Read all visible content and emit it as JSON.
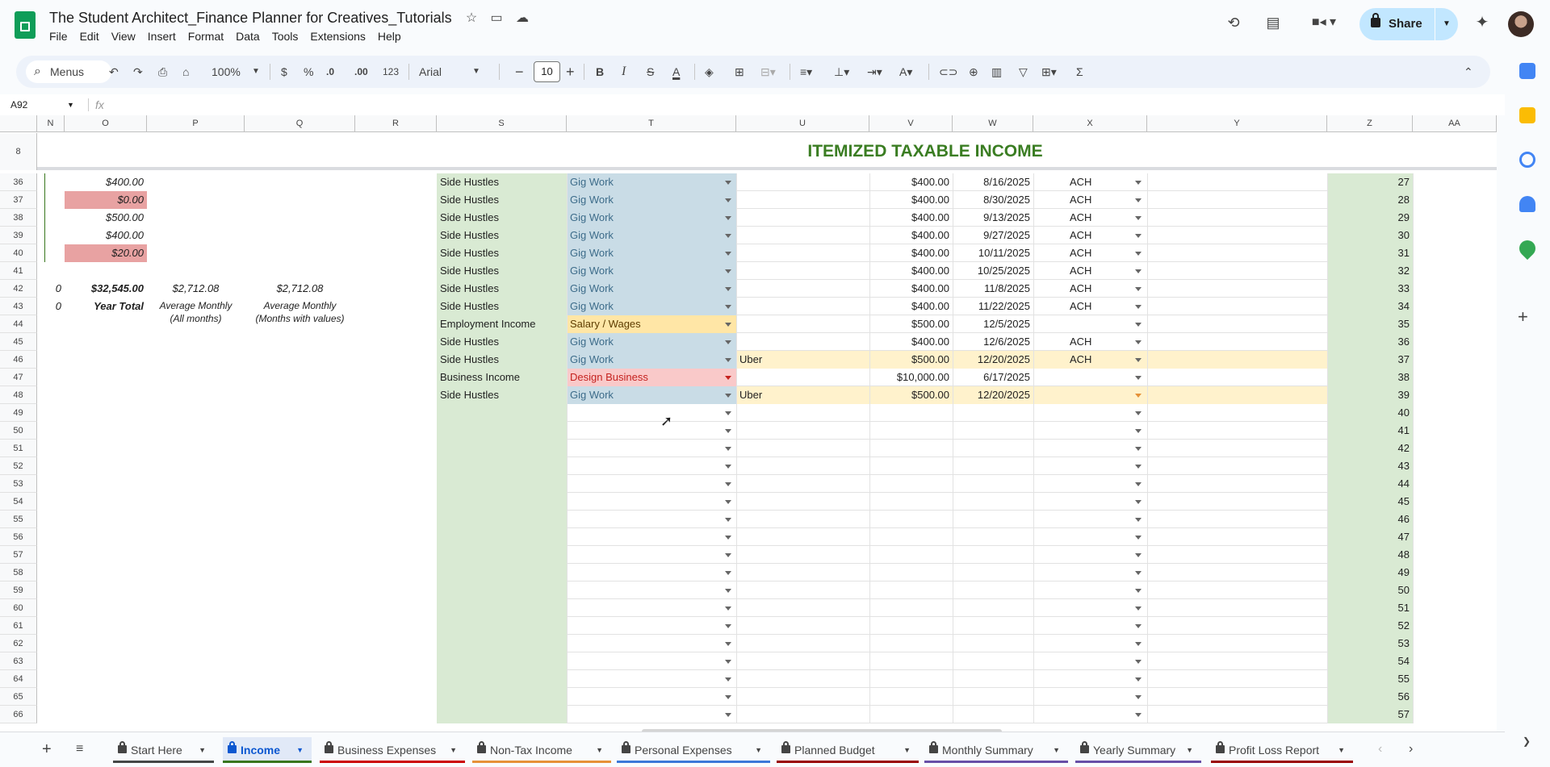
{
  "app": {
    "title": "The Student Architect_Finance Planner for Creatives_Tutorials",
    "menus": [
      "File",
      "Edit",
      "View",
      "Insert",
      "Format",
      "Data",
      "Tools",
      "Extensions",
      "Help"
    ],
    "share_label": "Share"
  },
  "toolbar": {
    "search_label": "Menus",
    "zoom": "100%",
    "currency": "$",
    "percent": "%",
    "dec_decrease": ".0",
    "dec_increase": ".00",
    "number_format": "123",
    "font": "Arial",
    "font_size": "10"
  },
  "formula_bar": {
    "cell_ref": "A92",
    "fx": "fx",
    "value": ""
  },
  "columns": [
    "N",
    "O",
    "P",
    "Q",
    "R",
    "S",
    "T",
    "U",
    "V",
    "W",
    "X",
    "Y",
    "Z",
    "AA"
  ],
  "frozen": {
    "row_number": "8",
    "heading": "ITEMIZED TAXABLE INCOME"
  },
  "left_values": [
    {
      "row": "36",
      "value": "$400.00",
      "flag": false
    },
    {
      "row": "37",
      "value": "$0.00",
      "flag": true
    },
    {
      "row": "38",
      "value": "$500.00",
      "flag": false
    },
    {
      "row": "39",
      "value": "$400.00",
      "flag": false
    },
    {
      "row": "40",
      "value": "$20.00",
      "flag": true
    }
  ],
  "summary": {
    "n42": "0",
    "n43": "0",
    "total": "$32,545.00",
    "total_label": "Year Total",
    "avg_all": "$2,712.08",
    "avg_all_label_1": "Average Monthly",
    "avg_all_label_2": "(All months)",
    "avg_values": "$2,712.08",
    "avg_values_label_1": "Average Monthly",
    "avg_values_label_2": "(Months with values)"
  },
  "rows": [
    {
      "row": "36",
      "category": "Side Hustles",
      "type": "Gig Work",
      "type_style": "blue",
      "source": "",
      "amount": "$400.00",
      "date": "8/16/2025",
      "method": "ACH",
      "num": "27",
      "highlight": false
    },
    {
      "row": "37",
      "category": "Side Hustles",
      "type": "Gig Work",
      "type_style": "blue",
      "source": "",
      "amount": "$400.00",
      "date": "8/30/2025",
      "method": "ACH",
      "num": "28",
      "highlight": false
    },
    {
      "row": "38",
      "category": "Side Hustles",
      "type": "Gig Work",
      "type_style": "blue",
      "source": "",
      "amount": "$400.00",
      "date": "9/13/2025",
      "method": "ACH",
      "num": "29",
      "highlight": false
    },
    {
      "row": "39",
      "category": "Side Hustles",
      "type": "Gig Work",
      "type_style": "blue",
      "source": "",
      "amount": "$400.00",
      "date": "9/27/2025",
      "method": "ACH",
      "num": "30",
      "highlight": false
    },
    {
      "row": "40",
      "category": "Side Hustles",
      "type": "Gig Work",
      "type_style": "blue",
      "source": "",
      "amount": "$400.00",
      "date": "10/11/2025",
      "method": "ACH",
      "num": "31",
      "highlight": false
    },
    {
      "row": "41",
      "category": "Side Hustles",
      "type": "Gig Work",
      "type_style": "blue",
      "source": "",
      "amount": "$400.00",
      "date": "10/25/2025",
      "method": "ACH",
      "num": "32",
      "highlight": false
    },
    {
      "row": "42",
      "category": "Side Hustles",
      "type": "Gig Work",
      "type_style": "blue",
      "source": "",
      "amount": "$400.00",
      "date": "11/8/2025",
      "method": "ACH",
      "num": "33",
      "highlight": false
    },
    {
      "row": "43",
      "category": "Side Hustles",
      "type": "Gig Work",
      "type_style": "blue",
      "source": "",
      "amount": "$400.00",
      "date": "11/22/2025",
      "method": "ACH",
      "num": "34",
      "highlight": false
    },
    {
      "row": "44",
      "category": "Employment Income",
      "type": "Salary / Wages",
      "type_style": "yellow",
      "source": "",
      "amount": "$500.00",
      "date": "12/5/2025",
      "method": "",
      "num": "35",
      "highlight": false
    },
    {
      "row": "45",
      "category": "Side Hustles",
      "type": "Gig Work",
      "type_style": "blue",
      "source": "",
      "amount": "$400.00",
      "date": "12/6/2025",
      "method": "ACH",
      "num": "36",
      "highlight": false
    },
    {
      "row": "46",
      "category": "Side Hustles",
      "type": "Gig Work",
      "type_style": "blue",
      "source": "Uber",
      "amount": "$500.00",
      "date": "12/20/2025",
      "method": "ACH",
      "num": "37",
      "highlight": true
    },
    {
      "row": "47",
      "category": "Business Income",
      "type": "Design Business",
      "type_style": "red",
      "source": "",
      "amount": "$10,000.00",
      "date": "6/17/2025",
      "method": "",
      "num": "38",
      "highlight": false
    },
    {
      "row": "48",
      "category": "Side Hustles",
      "type": "Gig Work",
      "type_style": "blue",
      "source": "Uber",
      "amount": "$500.00",
      "date": "12/20/2025",
      "method": "",
      "num": "39",
      "highlight": true
    },
    {
      "row": "49",
      "category": "",
      "type": "",
      "type_style": "",
      "source": "",
      "amount": "",
      "date": "",
      "method": "",
      "num": "40",
      "highlight": false
    },
    {
      "row": "50",
      "category": "",
      "type": "",
      "type_style": "",
      "source": "",
      "amount": "",
      "date": "",
      "method": "",
      "num": "41",
      "highlight": false
    },
    {
      "row": "51",
      "category": "",
      "type": "",
      "type_style": "",
      "source": "",
      "amount": "",
      "date": "",
      "method": "",
      "num": "42",
      "highlight": false
    },
    {
      "row": "52",
      "category": "",
      "type": "",
      "type_style": "",
      "source": "",
      "amount": "",
      "date": "",
      "method": "",
      "num": "43",
      "highlight": false
    },
    {
      "row": "53",
      "category": "",
      "type": "",
      "type_style": "",
      "source": "",
      "amount": "",
      "date": "",
      "method": "",
      "num": "44",
      "highlight": false
    },
    {
      "row": "54",
      "category": "",
      "type": "",
      "type_style": "",
      "source": "",
      "amount": "",
      "date": "",
      "method": "",
      "num": "45",
      "highlight": false
    },
    {
      "row": "55",
      "category": "",
      "type": "",
      "type_style": "",
      "source": "",
      "amount": "",
      "date": "",
      "method": "",
      "num": "46",
      "highlight": false
    },
    {
      "row": "56",
      "category": "",
      "type": "",
      "type_style": "",
      "source": "",
      "amount": "",
      "date": "",
      "method": "",
      "num": "47",
      "highlight": false
    },
    {
      "row": "57",
      "category": "",
      "type": "",
      "type_style": "",
      "source": "",
      "amount": "",
      "date": "",
      "method": "",
      "num": "48",
      "highlight": false
    },
    {
      "row": "58",
      "category": "",
      "type": "",
      "type_style": "",
      "source": "",
      "amount": "",
      "date": "",
      "method": "",
      "num": "49",
      "highlight": false
    },
    {
      "row": "59",
      "category": "",
      "type": "",
      "type_style": "",
      "source": "",
      "amount": "",
      "date": "",
      "method": "",
      "num": "50",
      "highlight": false
    },
    {
      "row": "60",
      "category": "",
      "type": "",
      "type_style": "",
      "source": "",
      "amount": "",
      "date": "",
      "method": "",
      "num": "51",
      "highlight": false
    },
    {
      "row": "61",
      "category": "",
      "type": "",
      "type_style": "",
      "source": "",
      "amount": "",
      "date": "",
      "method": "",
      "num": "52",
      "highlight": false
    },
    {
      "row": "62",
      "category": "",
      "type": "",
      "type_style": "",
      "source": "",
      "amount": "",
      "date": "",
      "method": "",
      "num": "53",
      "highlight": false
    },
    {
      "row": "63",
      "category": "",
      "type": "",
      "type_style": "",
      "source": "",
      "amount": "",
      "date": "",
      "method": "",
      "num": "54",
      "highlight": false
    },
    {
      "row": "64",
      "category": "",
      "type": "",
      "type_style": "",
      "source": "",
      "amount": "",
      "date": "",
      "method": "",
      "num": "55",
      "highlight": false
    },
    {
      "row": "65",
      "category": "",
      "type": "",
      "type_style": "",
      "source": "",
      "amount": "",
      "date": "",
      "method": "",
      "num": "56",
      "highlight": false
    },
    {
      "row": "66",
      "category": "",
      "type": "",
      "type_style": "",
      "source": "",
      "amount": "",
      "date": "",
      "method": "",
      "num": "57",
      "highlight": false
    }
  ],
  "sheet_tabs": [
    {
      "label": "Start Here",
      "color": "#444746",
      "active": false
    },
    {
      "label": "Income",
      "color": "#38761d",
      "active": true
    },
    {
      "label": "Business Expenses",
      "color": "#cc0000",
      "active": false
    },
    {
      "label": "Non-Tax Income",
      "color": "#e69138",
      "active": false
    },
    {
      "label": "Personal Expenses",
      "color": "#3c78d8",
      "active": false
    },
    {
      "label": "Planned Budget",
      "color": "#990000",
      "active": false
    },
    {
      "label": "Monthly Summary",
      "color": "#674ea7",
      "active": false
    },
    {
      "label": "Yearly Summary",
      "color": "#674ea7",
      "active": false
    },
    {
      "label": "Profit Loss Report",
      "color": "#990000",
      "active": false
    }
  ],
  "colors": {
    "accent": "#0b57d0",
    "heading_green": "#3a7d22",
    "share_bg": "#c2e7ff"
  }
}
